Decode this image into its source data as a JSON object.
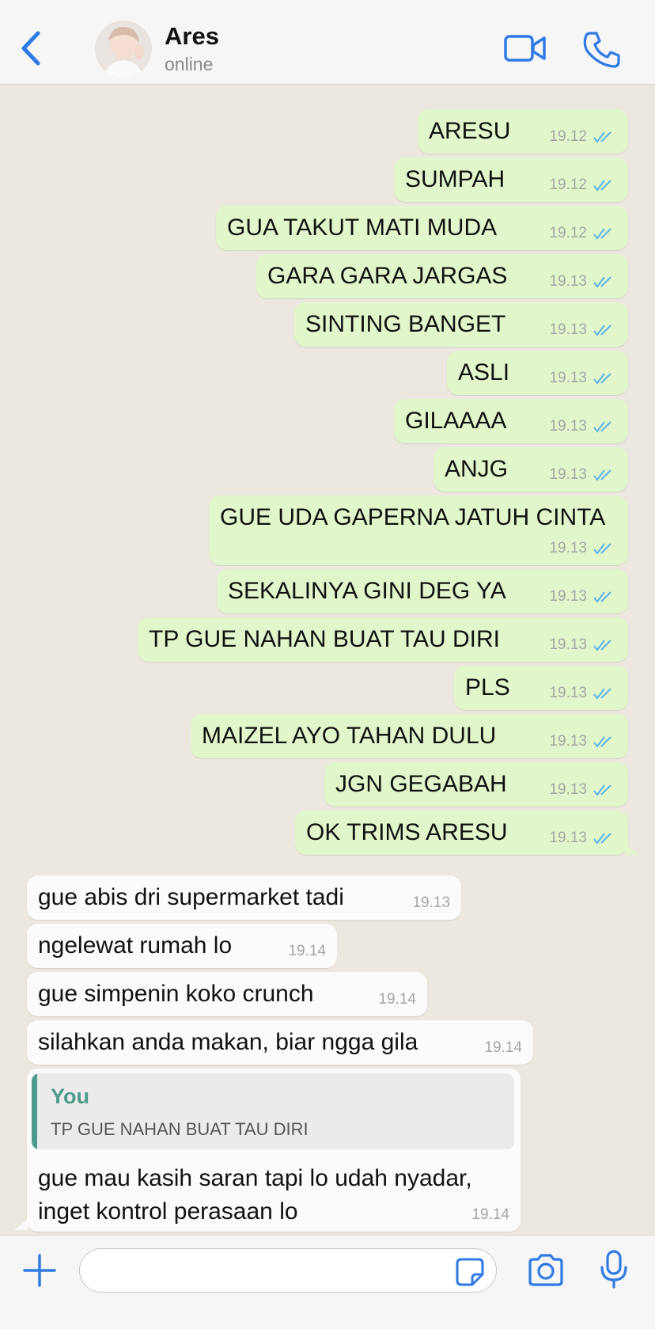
{
  "header": {
    "contact_name": "Ares",
    "contact_status": "online"
  },
  "outgoing": [
    {
      "text": "ARESU",
      "time": "19.12"
    },
    {
      "text": "SUMPAH",
      "time": "19.12"
    },
    {
      "text": "GUA TAKUT MATI MUDA",
      "time": "19.12"
    },
    {
      "text": "GARA GARA JARGAS",
      "time": "19.13"
    },
    {
      "text": "SINTING BANGET",
      "time": "19.13"
    },
    {
      "text": "ASLI",
      "time": "19.13"
    },
    {
      "text": "GILAAAA",
      "time": "19.13"
    },
    {
      "text": "ANJG",
      "time": "19.13"
    },
    {
      "text": "GUE UDA GAPERNA JATUH CINTA",
      "time": "19.13"
    },
    {
      "text": "SEKALINYA GINI DEG YA",
      "time": "19.13"
    },
    {
      "text": "TP GUE NAHAN BUAT TAU DIRI",
      "time": "19.13"
    },
    {
      "text": "PLS",
      "time": "19.13"
    },
    {
      "text": "MAIZEL AYO TAHAN DULU",
      "time": "19.13"
    },
    {
      "text": "JGN GEGABAH",
      "time": "19.13"
    },
    {
      "text": "OK TRIMS ARESU",
      "time": "19.13"
    }
  ],
  "incoming": [
    {
      "text": "gue abis dri supermarket tadi",
      "time": "19.13"
    },
    {
      "text": "ngelewat rumah lo",
      "time": "19.14"
    },
    {
      "text": "gue simpenin koko crunch",
      "time": "19.14"
    },
    {
      "text": "silahkan anda makan, biar ngga gila",
      "time": "19.14"
    }
  ],
  "reply": {
    "quote_author": "You",
    "quote_text": "TP GUE NAHAN BUAT TAU DIRI",
    "line1": "gue mau kasih saran tapi lo udah nyadar,",
    "line2": "inget kontrol perasaan lo",
    "time": "19.14"
  },
  "input": {
    "placeholder": ""
  },
  "colors": {
    "accent": "#2f7ae5",
    "outgoing_bubble": "#e1f7cb",
    "incoming_bubble": "#fbfbfb",
    "chat_background": "#ece8df",
    "read_ticks": "#5ab0e8",
    "quote_accent": "#4f9b8b"
  },
  "icons": [
    "back-chevron-icon",
    "video-call-icon",
    "phone-call-icon",
    "plus-icon",
    "sticker-icon",
    "camera-icon",
    "microphone-icon",
    "double-check-icon"
  ]
}
